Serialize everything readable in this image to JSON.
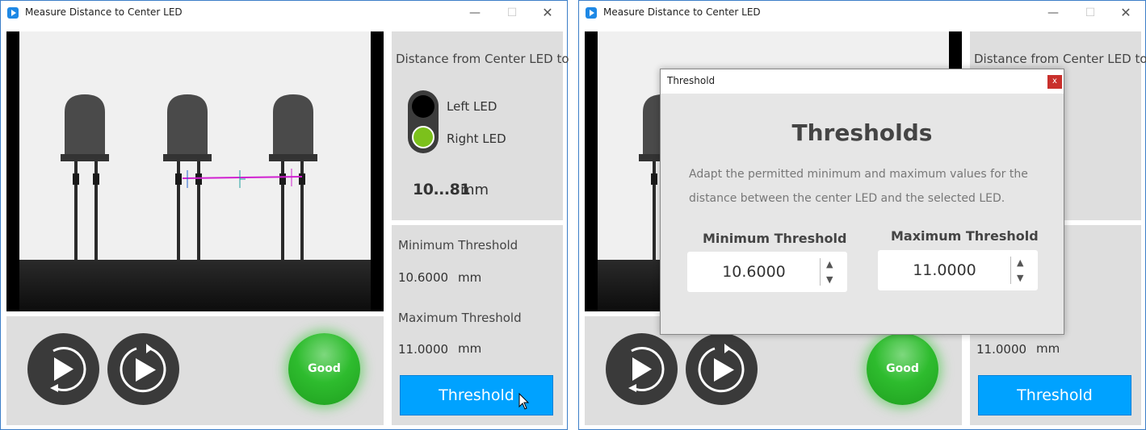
{
  "window": {
    "title": "Measure Distance to Center LED",
    "minimize": "—",
    "maximize": "☐",
    "close": "✕"
  },
  "measure": {
    "label": "Distance from Center LED to",
    "options": [
      "Left LED",
      "Right LED"
    ],
    "selected": "Right LED",
    "value": "10...81",
    "unit": "mm"
  },
  "status": {
    "label": "Good",
    "color": "#2ebc2e"
  },
  "thresholds": {
    "min_label": "Minimum Threshold",
    "min_value": "10.6000",
    "max_label": "Maximum Threshold",
    "max_value": "11.0000",
    "unit": "mm",
    "button_label": "Threshold"
  },
  "dialog": {
    "title": "Threshold",
    "close": "x",
    "heading": "Thresholds",
    "description": "Adapt the permitted minimum and maximum values for the distance between the center LED and the selected LED.",
    "min_label": "Minimum Threshold",
    "min_value": "10.6000",
    "max_label": "Maximum Threshold",
    "max_value": "11.0000",
    "up": "▲",
    "down": "▼"
  },
  "colors": {
    "accent": "#00a2ff",
    "toggle_on": "#7cc11c",
    "measure_line": "#d020d0"
  },
  "icons": [
    "app-icon",
    "play-repeat-icon",
    "play-loop-icon",
    "mouse-cursor-icon"
  ]
}
